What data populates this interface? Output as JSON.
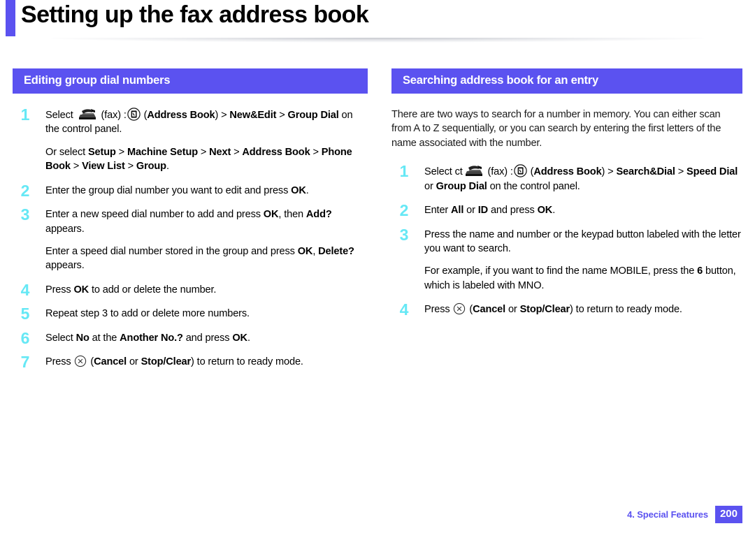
{
  "page": {
    "title": "Setting up the fax address book",
    "accent_color": "#5b52f0",
    "step_number_color": "#66e8f5"
  },
  "left_column": {
    "section_title": "Editing group dial numbers",
    "steps": [
      {
        "num": "1",
        "lines": [
          {
            "segments": [
              {
                "t": "Select ",
                "b": false
              },
              {
                "icon": "fax-machine-icon"
              },
              {
                "t": " (fax) :",
                "b": false
              },
              {
                "icon": "address-book-icon"
              },
              {
                "t": " (",
                "b": false
              },
              {
                "t": "Address Book",
                "b": true
              },
              {
                "t": ") > ",
                "b": false
              },
              {
                "t": "New&Edit",
                "b": true
              },
              {
                "t": " > ",
                "b": false
              },
              {
                "t": "Group Dial",
                "b": true
              },
              {
                "t": " on the control panel.",
                "b": false
              }
            ]
          },
          {
            "segments": [
              {
                "t": "Or select ",
                "b": false
              },
              {
                "t": "Setup",
                "b": true
              },
              {
                "t": " > ",
                "b": false
              },
              {
                "t": "Machine Setup",
                "b": true
              },
              {
                "t": " > ",
                "b": false
              },
              {
                "t": "Next",
                "b": true
              },
              {
                "t": " > ",
                "b": false
              },
              {
                "t": "Address Book",
                "b": true
              },
              {
                "t": " > ",
                "b": false
              },
              {
                "t": "Phone Book",
                "b": true
              },
              {
                "t": " > ",
                "b": false
              },
              {
                "t": "View List",
                "b": true
              },
              {
                "t": " > ",
                "b": false
              },
              {
                "t": "Group",
                "b": true
              },
              {
                "t": ".",
                "b": false
              }
            ]
          }
        ]
      },
      {
        "num": "2",
        "lines": [
          {
            "segments": [
              {
                "t": "Enter the group dial number you want to edit and press ",
                "b": false
              },
              {
                "t": "OK",
                "b": true
              },
              {
                "t": ".",
                "b": false
              }
            ]
          }
        ]
      },
      {
        "num": "3",
        "lines": [
          {
            "segments": [
              {
                "t": "Enter a new speed dial number to add and press ",
                "b": false
              },
              {
                "t": "OK",
                "b": true
              },
              {
                "t": ", then ",
                "b": false
              },
              {
                "t": "Add?",
                "b": true
              },
              {
                "t": " appears.",
                "b": false
              }
            ]
          },
          {
            "segments": [
              {
                "t": "Enter a speed dial number stored in the group and press ",
                "b": false
              },
              {
                "t": "OK",
                "b": true
              },
              {
                "t": ", ",
                "b": false
              },
              {
                "t": "Delete?",
                "b": true
              },
              {
                "t": " appears.",
                "b": false
              }
            ]
          }
        ]
      },
      {
        "num": "4",
        "lines": [
          {
            "segments": [
              {
                "t": "Press ",
                "b": false
              },
              {
                "t": "OK",
                "b": true
              },
              {
                "t": " to add or delete the number.",
                "b": false
              }
            ]
          }
        ]
      },
      {
        "num": "5",
        "lines": [
          {
            "segments": [
              {
                "t": "Repeat step 3 to add or delete more numbers.",
                "b": false
              }
            ]
          }
        ]
      },
      {
        "num": "6",
        "lines": [
          {
            "segments": [
              {
                "t": "Select ",
                "b": false
              },
              {
                "t": "No",
                "b": true
              },
              {
                "t": " at the ",
                "b": false
              },
              {
                "t": "Another No.?",
                "b": true
              },
              {
                "t": " and press ",
                "b": false
              },
              {
                "t": "OK",
                "b": true
              },
              {
                "t": ".",
                "b": false
              }
            ]
          }
        ]
      },
      {
        "num": "7",
        "lines": [
          {
            "segments": [
              {
                "t": "Press ",
                "b": false
              },
              {
                "icon": "cancel-circle-icon"
              },
              {
                "t": " (",
                "b": false
              },
              {
                "t": "Cancel",
                "b": true
              },
              {
                "t": " or ",
                "b": false
              },
              {
                "t": "Stop/Clear",
                "b": true
              },
              {
                "t": ") to return to ready mode.",
                "b": false
              }
            ]
          }
        ]
      }
    ]
  },
  "right_column": {
    "section_title": "Searching address book for an entry",
    "intro": "There are two ways to search for a number in memory. You can either scan from A to Z sequentially, or you can search by entering the first letters of the name associated with the number.",
    "steps": [
      {
        "num": "1",
        "lines": [
          {
            "segments": [
              {
                "t": "Select ct",
                "b": false
              },
              {
                "icon": "fax-machine-icon"
              },
              {
                "t": " (fax) :",
                "b": false
              },
              {
                "icon": "address-book-icon"
              },
              {
                "t": " (",
                "b": false
              },
              {
                "t": "Address Book",
                "b": true
              },
              {
                "t": ") > ",
                "b": false
              },
              {
                "t": "Search&Dial",
                "b": true
              },
              {
                "t": " > ",
                "b": false
              },
              {
                "t": "Speed Dial",
                "b": true
              },
              {
                "t": " or ",
                "b": false
              },
              {
                "t": "Group Dial",
                "b": true
              },
              {
                "t": " on the control panel.",
                "b": false
              }
            ]
          }
        ]
      },
      {
        "num": "2",
        "lines": [
          {
            "segments": [
              {
                "t": "Enter ",
                "b": false
              },
              {
                "t": "All",
                "b": true
              },
              {
                "t": " or ",
                "b": false
              },
              {
                "t": "ID",
                "b": true
              },
              {
                "t": " and press ",
                "b": false
              },
              {
                "t": "OK",
                "b": true
              },
              {
                "t": ".",
                "b": false
              }
            ]
          }
        ]
      },
      {
        "num": "3",
        "lines": [
          {
            "segments": [
              {
                "t": "Press the name and number or the keypad button labeled with the letter you want to search.",
                "b": false
              }
            ]
          },
          {
            "segments": [
              {
                "t": "For example, if you want to find the name ",
                "b": false
              },
              {
                "t": "MOBILE",
                "b": false
              },
              {
                "t": ", press the ",
                "b": false
              },
              {
                "t": "6",
                "b": true
              },
              {
                "t": " button, which is labeled with ",
                "b": false
              },
              {
                "t": "MNO",
                "b": false
              },
              {
                "t": ".",
                "b": false
              }
            ]
          }
        ]
      },
      {
        "num": "4",
        "lines": [
          {
            "segments": [
              {
                "t": "Press ",
                "b": false
              },
              {
                "icon": "cancel-circle-icon"
              },
              {
                "t": " (",
                "b": false
              },
              {
                "t": "Cancel",
                "b": true
              },
              {
                "t": " or ",
                "b": false
              },
              {
                "t": "Stop/Clear",
                "b": true
              },
              {
                "t": ") to return to ready mode.",
                "b": false
              }
            ]
          }
        ]
      }
    ]
  },
  "footer": {
    "chapter": "4.  Special Features",
    "page_number": "200"
  }
}
